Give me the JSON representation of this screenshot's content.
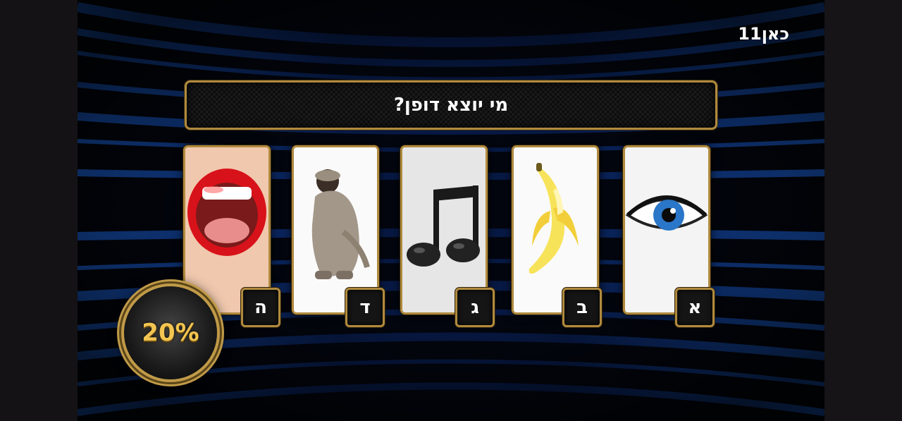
{
  "channel": {
    "logo_text": "כאן11"
  },
  "question": {
    "text": "מי יוצא דופן?"
  },
  "answers": [
    {
      "letter": "א",
      "picture": "eye-picture"
    },
    {
      "letter": "ב",
      "picture": "banana-picture"
    },
    {
      "letter": "ג",
      "picture": "music-note-picture"
    },
    {
      "letter": "ד",
      "picture": "monkey-picture"
    },
    {
      "letter": "ה",
      "picture": "mouth-picture"
    }
  ],
  "lifeline": {
    "label": "20%"
  },
  "colors": {
    "gold_frame": "#b08a3e",
    "background_blue": "#1a5fd0",
    "lifeline_gold": "#f2c451"
  }
}
